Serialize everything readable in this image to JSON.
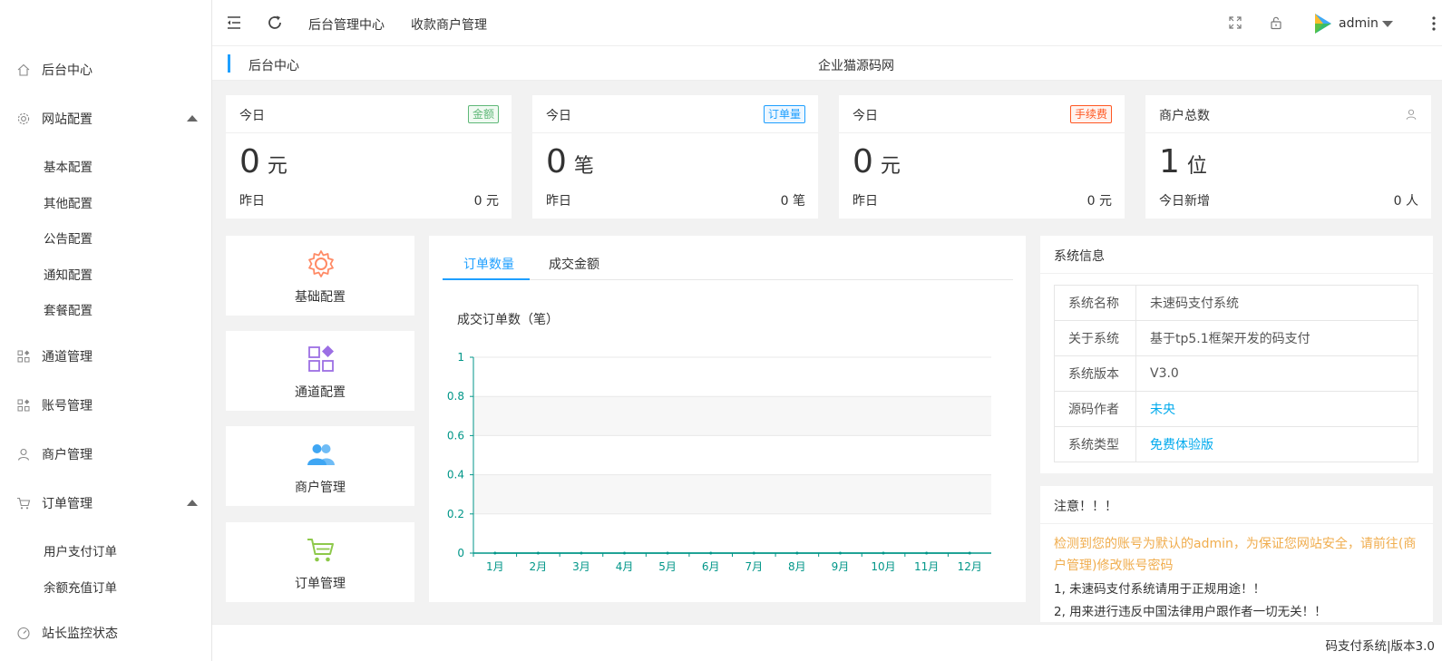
{
  "sidebar": {
    "items": [
      {
        "label": "后台中心",
        "icon": "home-icon"
      },
      {
        "label": "网站配置",
        "icon": "gear-icon",
        "expanded": true
      },
      {
        "label": "通道管理",
        "icon": "grid-icon"
      },
      {
        "label": "账号管理",
        "icon": "grid-icon"
      },
      {
        "label": "商户管理",
        "icon": "user-icon"
      },
      {
        "label": "订单管理",
        "icon": "cart-icon",
        "expanded": true
      },
      {
        "label": "站长监控状态",
        "icon": "dashboard-icon"
      }
    ],
    "sub_site": [
      "基本配置",
      "其他配置",
      "公告配置",
      "通知配置",
      "套餐配置"
    ],
    "sub_order": [
      "用户支付订单",
      "余额充值订单"
    ]
  },
  "header": {
    "tabs": [
      "后台管理中心",
      "收款商户管理"
    ],
    "username": "admin"
  },
  "breadcrumb": {
    "current": "后台中心",
    "site_name": "企业猫源码网"
  },
  "stats": [
    {
      "head": "今日",
      "badge": "金额",
      "badge_color": "#5fb878",
      "value": "0",
      "unit": "元",
      "sub_label": "昨日",
      "sub_value": "0 元"
    },
    {
      "head": "今日",
      "badge": "订单量",
      "badge_color": "#1e9fff",
      "value": "0",
      "unit": "笔",
      "sub_label": "昨日",
      "sub_value": "0 笔"
    },
    {
      "head": "今日",
      "badge": "手续费",
      "badge_color": "#ff5722",
      "value": "0",
      "unit": "元",
      "sub_label": "昨日",
      "sub_value": "0 元"
    },
    {
      "head": "商户总数",
      "badge": "",
      "value": "1",
      "unit": "位",
      "sub_label": "今日新增",
      "sub_value": "0 人"
    }
  ],
  "shortcuts": [
    {
      "label": "基础配置",
      "icon": "gear-icon",
      "color": "#ff8a65"
    },
    {
      "label": "通道配置",
      "icon": "shapes-icon",
      "color": "#9c6fe4"
    },
    {
      "label": "商户管理",
      "icon": "users-icon",
      "color": "#3fa6f3"
    },
    {
      "label": "订单管理",
      "icon": "cart-icon",
      "color": "#8ec94b"
    }
  ],
  "chart_tabs": [
    "订单数量",
    "成交金额"
  ],
  "chart_data": {
    "type": "line",
    "title": "成交订单数（笔）",
    "categories": [
      "1月",
      "2月",
      "3月",
      "4月",
      "5月",
      "6月",
      "7月",
      "8月",
      "9月",
      "10月",
      "11月",
      "12月"
    ],
    "series": [
      {
        "values": [
          0,
          0,
          0,
          0,
          0,
          0,
          0,
          0,
          0,
          0,
          0,
          0
        ]
      }
    ],
    "yticks": [
      "0",
      "0.2",
      "0.4",
      "0.6",
      "0.8",
      "1"
    ],
    "ylim": [
      0,
      1
    ],
    "axis_color": "#009688",
    "grid": true
  },
  "sysinfo": {
    "title": "系统信息",
    "rows": [
      {
        "k": "系统名称",
        "v": "未速码支付系统",
        "link": false
      },
      {
        "k": "关于系统",
        "v": "基于tp5.1框架开发的码支付",
        "link": false
      },
      {
        "k": "系统版本",
        "v": "V3.0",
        "link": false
      },
      {
        "k": "源码作者",
        "v": "未央",
        "link": true
      },
      {
        "k": "系统类型",
        "v": "免费体验版",
        "link": true
      }
    ]
  },
  "notice": {
    "title": "注意！！！",
    "warning": "检测到您的账号为默认的admin，为保证您网站安全，请前往(商户管理)修改账号密码",
    "lines": [
      "1, 未速码支付系统请用于正规用途！！",
      "2, 用来进行违反中国法律用户跟作者一切无关！！"
    ]
  },
  "footer": {
    "text": "码支付系统|版本3.0"
  }
}
